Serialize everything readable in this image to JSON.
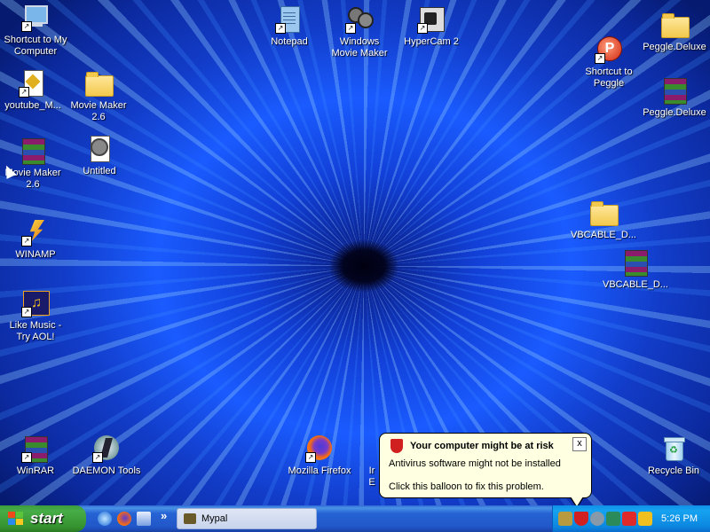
{
  "desktop": {
    "icons": [
      {
        "label_lines": [
          "Shortcut to My",
          "Computer"
        ],
        "icon": "computer-icon"
      },
      {
        "label_lines": [
          "youtube_M..."
        ],
        "icon": "document-icon"
      },
      {
        "label_lines": [
          "Movie Maker",
          "2.6"
        ],
        "icon": "folder-icon"
      },
      {
        "label_lines": [
          "Movie Maker",
          "2.6"
        ],
        "icon": "winrar-archive-icon"
      },
      {
        "label_lines": [
          "Untitled"
        ],
        "icon": "movie-project-icon"
      },
      {
        "label_lines": [
          "WINAMP"
        ],
        "icon": "winamp-icon"
      },
      {
        "label_lines": [
          "Like Music -",
          "Try AOL!"
        ],
        "icon": "aol-music-icon"
      },
      {
        "label_lines": [
          "Notepad"
        ],
        "icon": "notepad-icon"
      },
      {
        "label_lines": [
          "Windows",
          "Movie Maker"
        ],
        "icon": "movie-maker-icon"
      },
      {
        "label_lines": [
          "HyperCam 2"
        ],
        "icon": "hypercam-icon"
      },
      {
        "label_lines": [
          "Peggle.Deluxe"
        ],
        "icon": "folder-icon"
      },
      {
        "label_lines": [
          "Shortcut to",
          "Peggle"
        ],
        "icon": "peggle-icon"
      },
      {
        "label_lines": [
          "Peggle.Deluxe"
        ],
        "icon": "winrar-archive-icon"
      },
      {
        "label_lines": [
          "VBCABLE_D..."
        ],
        "icon": "folder-icon"
      },
      {
        "label_lines": [
          "VBCABLE_D..."
        ],
        "icon": "winrar-archive-icon"
      },
      {
        "label_lines": [
          "WinRAR"
        ],
        "icon": "winrar-icon"
      },
      {
        "label_lines": [
          "DAEMON Tools"
        ],
        "icon": "daemon-tools-icon"
      },
      {
        "label_lines": [
          "Mozilla Firefox"
        ],
        "icon": "firefox-icon"
      },
      {
        "label_lines": [
          "Ir",
          "E"
        ],
        "icon": "internet-explorer-icon"
      },
      {
        "label_lines": [
          "Recycle Bin"
        ],
        "icon": "recycle-bin-icon"
      }
    ]
  },
  "balloon": {
    "title": "Your computer might be at risk",
    "line1": "Antivirus software might not be installed",
    "line2": "Click this balloon to fix this problem.",
    "close": "x"
  },
  "taskbar": {
    "start_label": "start",
    "quick_launch": [
      "internet-explorer-icon",
      "firefox-icon",
      "show-desktop-icon"
    ],
    "overflow": "»",
    "window_button": "Mypal",
    "clock": "5:26 PM",
    "tray_icons": [
      "hypercam-tray-icon",
      "security-center-icon",
      "volume-icon",
      "network-icon",
      "daemon-tools-tray-icon",
      "winamp-agent-icon"
    ]
  },
  "colors": {
    "taskbar": "#2157c9",
    "start": "#3c9c3c",
    "tray": "#0c86e0",
    "balloon": "#ffffe1"
  }
}
